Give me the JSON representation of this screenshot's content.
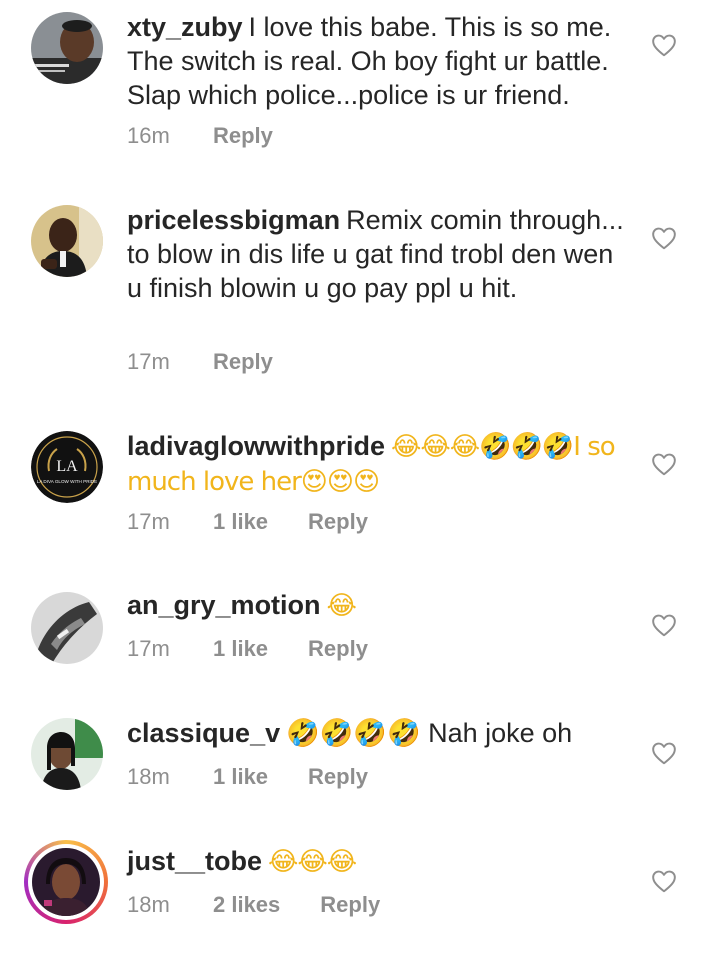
{
  "comments": [
    {
      "username": "xty_zuby",
      "text": "I love this babe. This is so me. The switch is real. Oh boy fight ur battle. Slap which police...police is ur friend.",
      "emoji": "",
      "time": "16m",
      "likes": "",
      "reply_label": "Reply",
      "heart_icon": "heart-outline"
    },
    {
      "username": "pricelessbigman",
      "text": "Remix comin through... to blow in dis life u gat find trobl den wen u finish blowin u go pay ppl u hit.",
      "emoji": "",
      "time": "17m",
      "likes": "",
      "reply_label": "Reply",
      "heart_icon": "heart-outline"
    },
    {
      "username": "ladivaglowwithpride",
      "text": "😂😂😂🤣🤣🤣I so much love her😍😍😍",
      "emoji": "",
      "time": "17m",
      "likes": "1 like",
      "reply_label": "Reply",
      "heart_icon": "heart-outline"
    },
    {
      "username": "an_gry_motion",
      "text": "😂",
      "emoji": "",
      "time": "17m",
      "likes": "1 like",
      "reply_label": "Reply",
      "heart_icon": "heart-outline"
    },
    {
      "username": "classique_v",
      "text": "🤣🤣🤣🤣 Nah joke oh",
      "emoji": "",
      "time": "18m",
      "likes": "1 like",
      "reply_label": "Reply",
      "heart_icon": "heart-outline"
    },
    {
      "username": "just__tobe",
      "text": "😂😂😂",
      "emoji": "",
      "time": "18m",
      "likes": "2 likes",
      "reply_label": "Reply",
      "heart_icon": "heart-outline"
    }
  ],
  "avatar_logo_text": "LA",
  "avatar_logo_caption": "LA DIVA GLOW WITH PRIDE"
}
